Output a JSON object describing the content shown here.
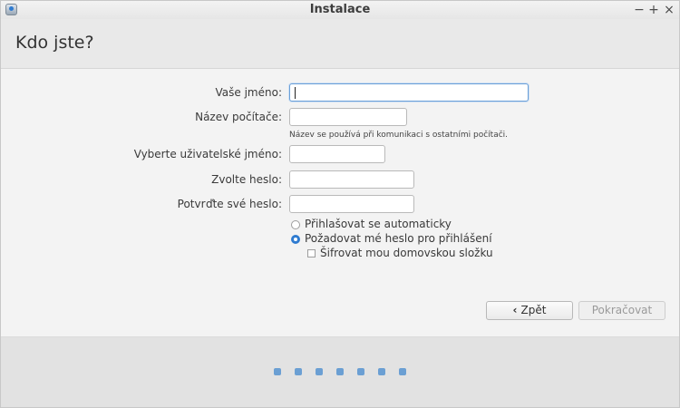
{
  "window": {
    "title": "Instalace",
    "minimize": "−",
    "maximize": "+",
    "close": "×"
  },
  "page_title": "Kdo jste?",
  "form": {
    "name_label": "Vaše jméno:",
    "name_value": "",
    "computer_label": "Název počítače:",
    "computer_value": "",
    "computer_hint": "Název se používá při komunikaci s ostatními počítači.",
    "username_label": "Vyberte uživatelské jméno:",
    "username_value": "",
    "password_label": "Zvolte heslo:",
    "confirm_label": "Potvrďte své heslo:"
  },
  "options": {
    "auto_login": {
      "label": "Přihlašovat se automaticky",
      "checked": false
    },
    "require_password": {
      "label": "Požadovat mé heslo pro přihlášení",
      "checked": true
    },
    "encrypt_home": {
      "label": "Šifrovat mou domovskou složku",
      "checked": false
    }
  },
  "buttons": {
    "back": "Zpět",
    "continue": "Pokračovat"
  },
  "progress": {
    "total_steps": 7
  },
  "colors": {
    "accent": "#2f7bd0",
    "dots": "#6b9fd3"
  }
}
